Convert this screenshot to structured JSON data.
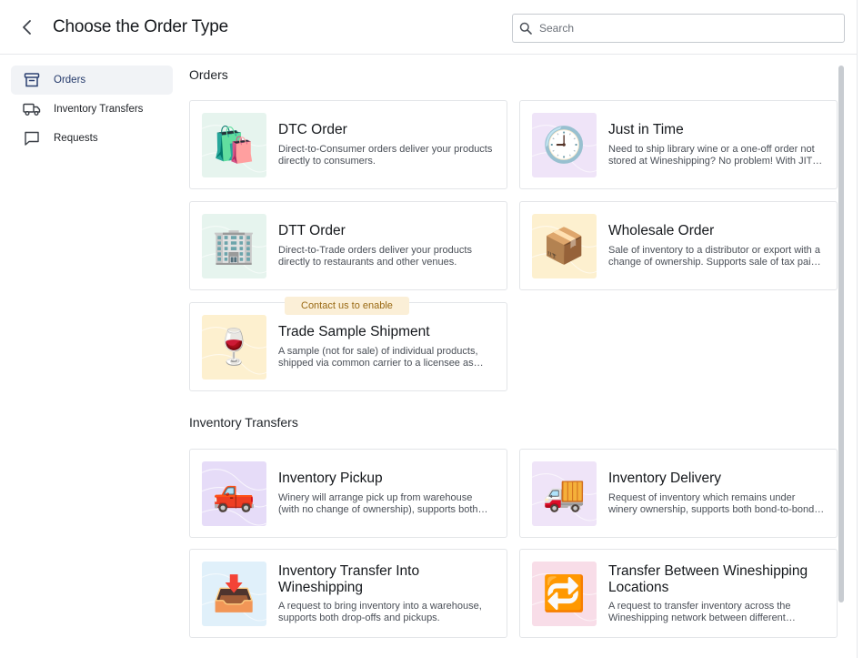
{
  "header": {
    "title": "Choose the Order Type",
    "search_placeholder": "Search"
  },
  "sidebar": {
    "items": [
      {
        "label": "Orders",
        "icon": "archive-box-icon",
        "active": true
      },
      {
        "label": "Inventory Transfers",
        "icon": "truck-icon",
        "active": false
      },
      {
        "label": "Requests",
        "icon": "chat-bubble-icon",
        "active": false
      }
    ]
  },
  "sections": {
    "orders": {
      "title": "Orders",
      "cards": [
        {
          "title": "DTC Order",
          "description": "Direct-to-Consumer orders deliver your products directly to consumers.",
          "icon": "shopping-bags-icon",
          "emoji": "🛍️",
          "bg": "#e6f4ee"
        },
        {
          "title": "Just in Time",
          "description": "Need to ship library wine or a one-off order not stored at Wineshipping? No problem! With JIT orders, you can ship your product directly.",
          "icon": "clock-icon",
          "emoji": "🕘",
          "bg": "#efe4f8"
        },
        {
          "title": "DTT Order",
          "description": "Direct-to-Trade orders deliver your products directly to restaurants and other venues.",
          "icon": "office-building-icon",
          "emoji": "🏢",
          "bg": "#e6f4ee"
        },
        {
          "title": "Wholesale Order",
          "description": "Sale of inventory to a distributor or export with a change of ownership. Supports sale of tax paid and bonded inventory.",
          "icon": "packages-icon",
          "emoji": "📦",
          "bg": "#fdf0cf"
        },
        {
          "title": "Trade Sample Shipment",
          "description": "A sample (not for sale) of individual products, shipped via common carrier to a licensee as permitted.",
          "icon": "wine-glass-icon",
          "emoji": "🍷",
          "bg": "#fdf0cf",
          "badge": "Contact us to enable"
        }
      ]
    },
    "transfers": {
      "title": "Inventory Transfers",
      "cards": [
        {
          "title": "Inventory Pickup",
          "description": "Winery will arrange pick up from warehouse (with no change of ownership), supports both bonded and tax paid.",
          "icon": "pickup-truck-icon",
          "emoji": "🛻",
          "bg": "#e6dcf8"
        },
        {
          "title": "Inventory Delivery",
          "description": "Request of inventory which remains under winery ownership, supports both bond-to-bond and tax paid deliveries.",
          "icon": "delivery-truck-icon",
          "emoji": "🚚",
          "bg": "#efe4f8"
        },
        {
          "title": "Inventory Transfer Into Wineshipping",
          "description": "A request to bring inventory into a warehouse, supports both drop-offs and pickups.",
          "icon": "inbox-tray-icon",
          "emoji": "📥",
          "bg": "#e0f0fa"
        },
        {
          "title": "Transfer Between Wineshipping Locations",
          "description": "A request to transfer inventory across the Wineshipping network between different warehouses.",
          "icon": "repeat-arrows-icon",
          "emoji": "🔁",
          "bg": "#f8dde8"
        }
      ]
    }
  }
}
